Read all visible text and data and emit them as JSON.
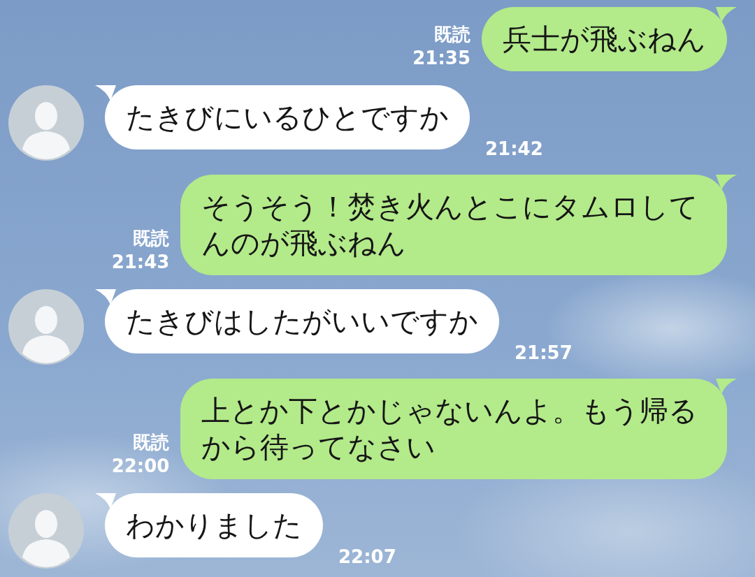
{
  "messages": [
    {
      "kind": "sent",
      "text": "兵士が飛ぶねん",
      "read_label": "既読",
      "time": "21:35"
    },
    {
      "kind": "received",
      "text": "たきびにいるひとですか",
      "time": "21:42"
    },
    {
      "kind": "sent",
      "text": "そうそう！焚き火んとこにタムロしてんのが飛ぶねん",
      "read_label": "既読",
      "time": "21:43"
    },
    {
      "kind": "received",
      "text": "たきびはしたがいいですか",
      "time": "21:57"
    },
    {
      "kind": "sent",
      "text": "上とか下とかじゃないんよ。もう帰るから待ってなさい",
      "read_label": "既読",
      "time": "22:00"
    },
    {
      "kind": "received",
      "text": "わかりました",
      "time": "22:07"
    }
  ]
}
